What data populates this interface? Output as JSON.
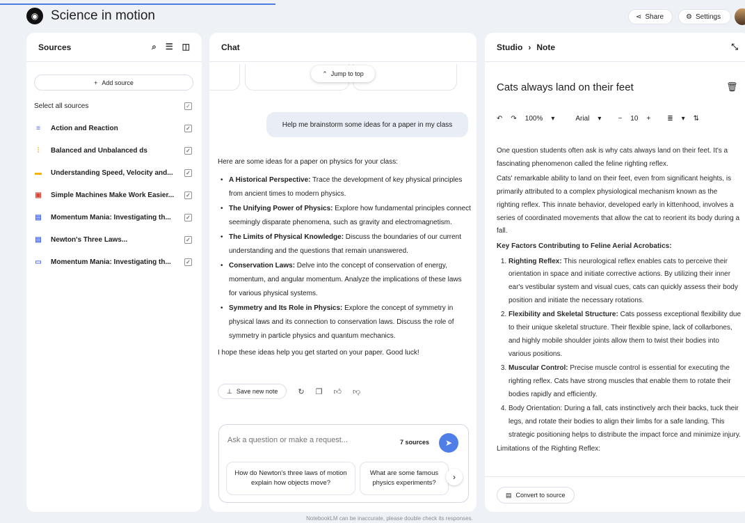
{
  "app": {
    "title": "Science in motion",
    "share": "Share",
    "settings": "Settings",
    "logo": "notebook-icon"
  },
  "sources": {
    "title": "Sources",
    "add": "Add source",
    "select_all": "Select all sources",
    "items": [
      {
        "name": "Action and Reaction",
        "icon": "document-icon",
        "color": "#4c6ef5"
      },
      {
        "name": "Balanced and Unbalanced ds",
        "icon": "audio-icon",
        "color": "#f4b400"
      },
      {
        "name": "Understanding Speed, Velocity and...",
        "icon": "slides-icon",
        "color": "#f4b400"
      },
      {
        "name": "Simple Machines Make Work Easier...",
        "icon": "pdf-icon",
        "color": "#db4437"
      },
      {
        "name": "Momentum Mania: Investigating th...",
        "icon": "doc-icon",
        "color": "#4c6ef5"
      },
      {
        "name": "Newton's Three Laws...",
        "icon": "doc-icon",
        "color": "#4c6ef5"
      },
      {
        "name": "Momentum Mania: Investigating th...",
        "icon": "web-icon",
        "color": "#4c6ef5"
      }
    ]
  },
  "chat": {
    "title": "Chat",
    "jump": "Jump to top",
    "prompt": "Help me brainstorm some ideas for a paper in my class",
    "intro": "Here are some ideas for a paper on physics for your class:",
    "ideas": [
      {
        "title": "A Historical Perspective:",
        "text": " Trace the development of key physical principles from ancient times to modern physics."
      },
      {
        "title": "The Unifying Power of Physics:",
        "text": " Explore how fundamental principles connect seemingly disparate phenomena, such as gravity and electromagnetism."
      },
      {
        "title": "The Limits of Physical Knowledge:",
        "text": " Discuss the boundaries of our current understanding and the questions that remain unanswered."
      },
      {
        "title": "Conservation Laws:",
        "text": " Delve into the concept of conservation of energy, momentum, and angular momentum. Analyze the implications of these laws for various physical systems."
      },
      {
        "title": "Symmetry and Its Role in Physics:",
        "text": " Explore the concept of symmetry in physical laws and its connection to conservation laws. Discuss the role of symmetry in particle physics and quantum mechanics."
      }
    ],
    "closing": "I hope these ideas help you get started on your paper. Good luck!",
    "save_note": "Save new note",
    "input_placeholder": "Ask a question or make a request...",
    "source_count": "7 sources",
    "suggestions": [
      "How do Newton's three laws of motion explain how objects move?",
      "What are some famous physics experiments?"
    ]
  },
  "studio": {
    "crumb1": "Studio",
    "crumb2": "Note",
    "note_title": "Cats always land on their feet",
    "toolbar": {
      "zoom": "100%",
      "font": "Arial",
      "size": "10"
    },
    "p1": "One question students often ask is why cats always land on their feet. It's a fascinating phenomenon called the feline righting reflex.",
    "p2": "Cats' remarkable ability to land on their feet, even from significant heights, is primarily attributed to a complex physiological mechanism known as the righting reflex. This innate behavior, developed early in kittenhood, involves a series of coordinated movements that allow the cat to reorient its body during a fall.",
    "heading": "Key Factors Contributing to Feline Aerial Acrobatics:",
    "factors": [
      {
        "title": "Righting Reflex:",
        "text": " This neurological reflex enables cats to perceive their orientation in space and initiate corrective actions. By utilizing their inner ear's vestibular system and visual cues, cats can quickly assess their body position and initiate the necessary rotations."
      },
      {
        "title": "Flexibility and Skeletal Structure:",
        "text": " Cats possess exceptional flexibility due to their unique skeletal structure. Their flexible spine, lack of collarbones, and highly mobile shoulder joints allow them to twist their bodies into various positions."
      },
      {
        "title": "Muscular Control:",
        "text": " Precise muscle control is essential for executing the righting reflex. Cats have strong muscles that enable them to rotate their bodies rapidly and efficiently."
      },
      {
        "title": "",
        "text": "Body Orientation: During a fall, cats instinctively arch their backs, tuck their legs, and rotate their bodies to align their limbs for a safe landing. This strategic positioning helps to distribute the impact force and minimize injury."
      }
    ],
    "limitations": "Limitations of the Righting Reflex:",
    "convert": "Convert to source"
  },
  "footer": "NotebookLM can be inaccurate, please double check its responses."
}
